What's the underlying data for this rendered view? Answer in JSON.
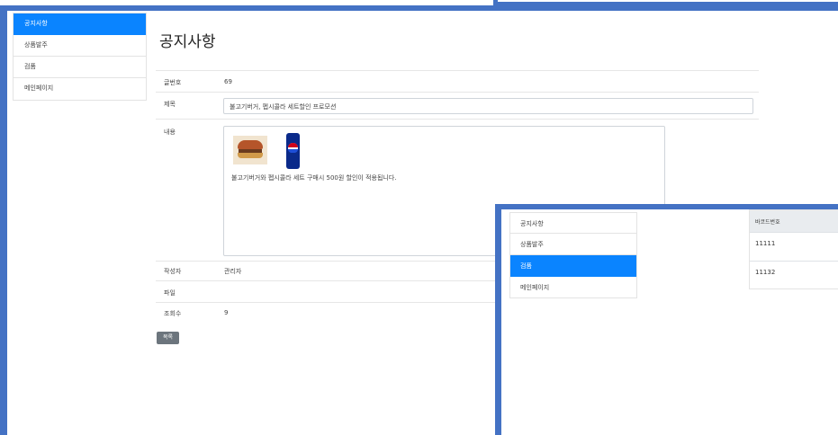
{
  "back_window": {
    "sidebar": {
      "items": [
        {
          "label": "공지사항",
          "active": true
        },
        {
          "label": "상품발주",
          "active": false
        },
        {
          "label": "검품",
          "active": false
        },
        {
          "label": "메인페이지",
          "active": false
        }
      ]
    },
    "page_title": "공지사항",
    "fields": {
      "post_no": {
        "label": "글번호",
        "value": "69"
      },
      "subject": {
        "label": "제목",
        "value": "불고기버거, 펩시콜라 세트할인 프로모션"
      },
      "content": {
        "label": "내용",
        "text": "불고기버거와 펩시콜라 세트 구매시 500원 할인이 적용됩니다."
      },
      "author": {
        "label": "작성자",
        "value": "관리자"
      },
      "file": {
        "label": "파일",
        "value": ""
      },
      "views": {
        "label": "조회수",
        "value": "9"
      }
    },
    "list_button": "목록"
  },
  "front_window": {
    "sidebar": {
      "items": [
        {
          "label": "공지사항",
          "active": false
        },
        {
          "label": "상품발주",
          "active": false
        },
        {
          "label": "검품",
          "active": true
        },
        {
          "label": "메인페이지",
          "active": false
        }
      ]
    },
    "table": {
      "header": "바코드번호",
      "rows": [
        "11111",
        "11132"
      ]
    }
  },
  "colors": {
    "frame": "#4472c4",
    "active": "#0a84ff",
    "button": "#6c757d"
  },
  "images": [
    "burger-image",
    "pepsi-can-image"
  ]
}
